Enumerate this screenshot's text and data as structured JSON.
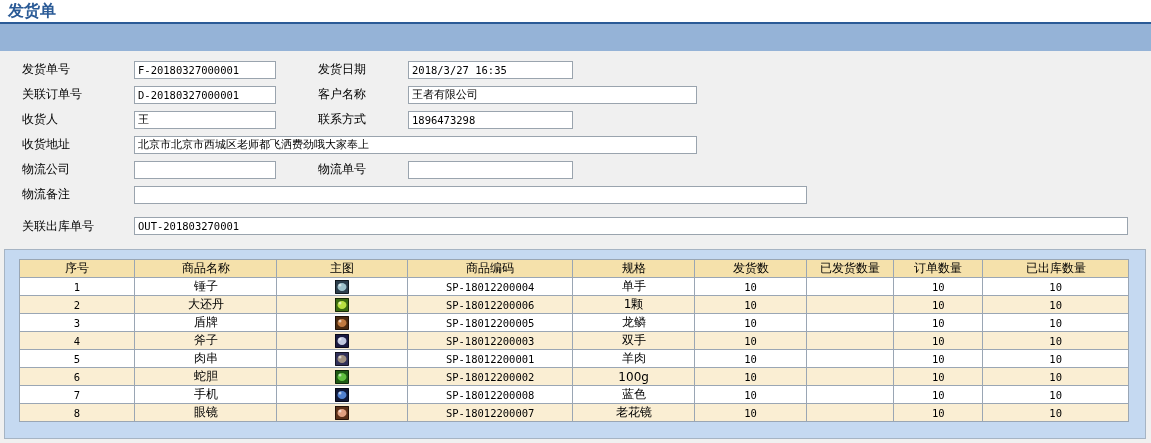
{
  "title": "发货单",
  "form_rows": [
    {
      "fields": [
        {
          "label": "发货单号",
          "value": "F-20180327000001",
          "kind": "short"
        },
        {
          "label": "发货日期",
          "value": "2018/3/27 16:35",
          "kind": "short"
        }
      ]
    },
    {
      "fields": [
        {
          "label": "关联订单号",
          "value": "D-20180327000001",
          "kind": "short"
        },
        {
          "label": "客户名称",
          "value": "王者有限公司",
          "kind": "medium"
        }
      ]
    },
    {
      "fields": [
        {
          "label": "收货人",
          "value": "王",
          "kind": "short"
        },
        {
          "label": "联系方式",
          "value": "1896473298",
          "kind": "short"
        }
      ]
    },
    {
      "fields": [
        {
          "label": "收货地址",
          "value": "北京市北京市西城区老师都飞洒费劲哦大家奉上",
          "kind": "long"
        }
      ]
    },
    {
      "fields": [
        {
          "label": "物流公司",
          "kind": "short"
        },
        {
          "label": "物流单号",
          "kind": "short"
        }
      ]
    },
    {
      "fields": [
        {
          "label": "物流备注",
          "kind": "longer"
        }
      ]
    },
    {
      "fields": [
        {
          "label": "关联出库单号",
          "value": "OUT-201803270001",
          "kind": "full"
        }
      ]
    }
  ],
  "table": {
    "columns": [
      "序号",
      "商品名称",
      "主图",
      "商品编码",
      "规格",
      "发货数",
      "已发货数量",
      "订单数量",
      "已出库数量"
    ],
    "rows": [
      {
        "no": "1",
        "name": "锤子",
        "code": "SP-18012200004",
        "spec": "单手",
        "ship_qty": "10",
        "order_qty": "10",
        "out_qty": "10"
      },
      {
        "no": "2",
        "name": "大还丹",
        "code": "SP-18012200006",
        "spec": "1颗",
        "ship_qty": "10",
        "order_qty": "10",
        "out_qty": "10"
      },
      {
        "no": "3",
        "name": "盾牌",
        "code": "SP-18012200005",
        "spec": "龙鳞",
        "ship_qty": "10",
        "order_qty": "10",
        "out_qty": "10"
      },
      {
        "no": "4",
        "name": "斧子",
        "code": "SP-18012200003",
        "spec": "双手",
        "ship_qty": "10",
        "order_qty": "10",
        "out_qty": "10"
      },
      {
        "no": "5",
        "name": "肉串",
        "code": "SP-18012200001",
        "spec": "羊肉",
        "ship_qty": "10",
        "order_qty": "10",
        "out_qty": "10"
      },
      {
        "no": "6",
        "name": "蛇胆",
        "code": "SP-18012200002",
        "spec": "100g",
        "ship_qty": "10",
        "order_qty": "10",
        "out_qty": "10"
      },
      {
        "no": "7",
        "name": "手机",
        "code": "SP-18012200008",
        "spec": "蓝色",
        "ship_qty": "10",
        "order_qty": "10",
        "out_qty": "10"
      },
      {
        "no": "8",
        "name": "眼镜",
        "code": "SP-18012200007",
        "spec": "老花镜",
        "ship_qty": "10",
        "order_qty": "10",
        "out_qty": "10"
      }
    ]
  }
}
